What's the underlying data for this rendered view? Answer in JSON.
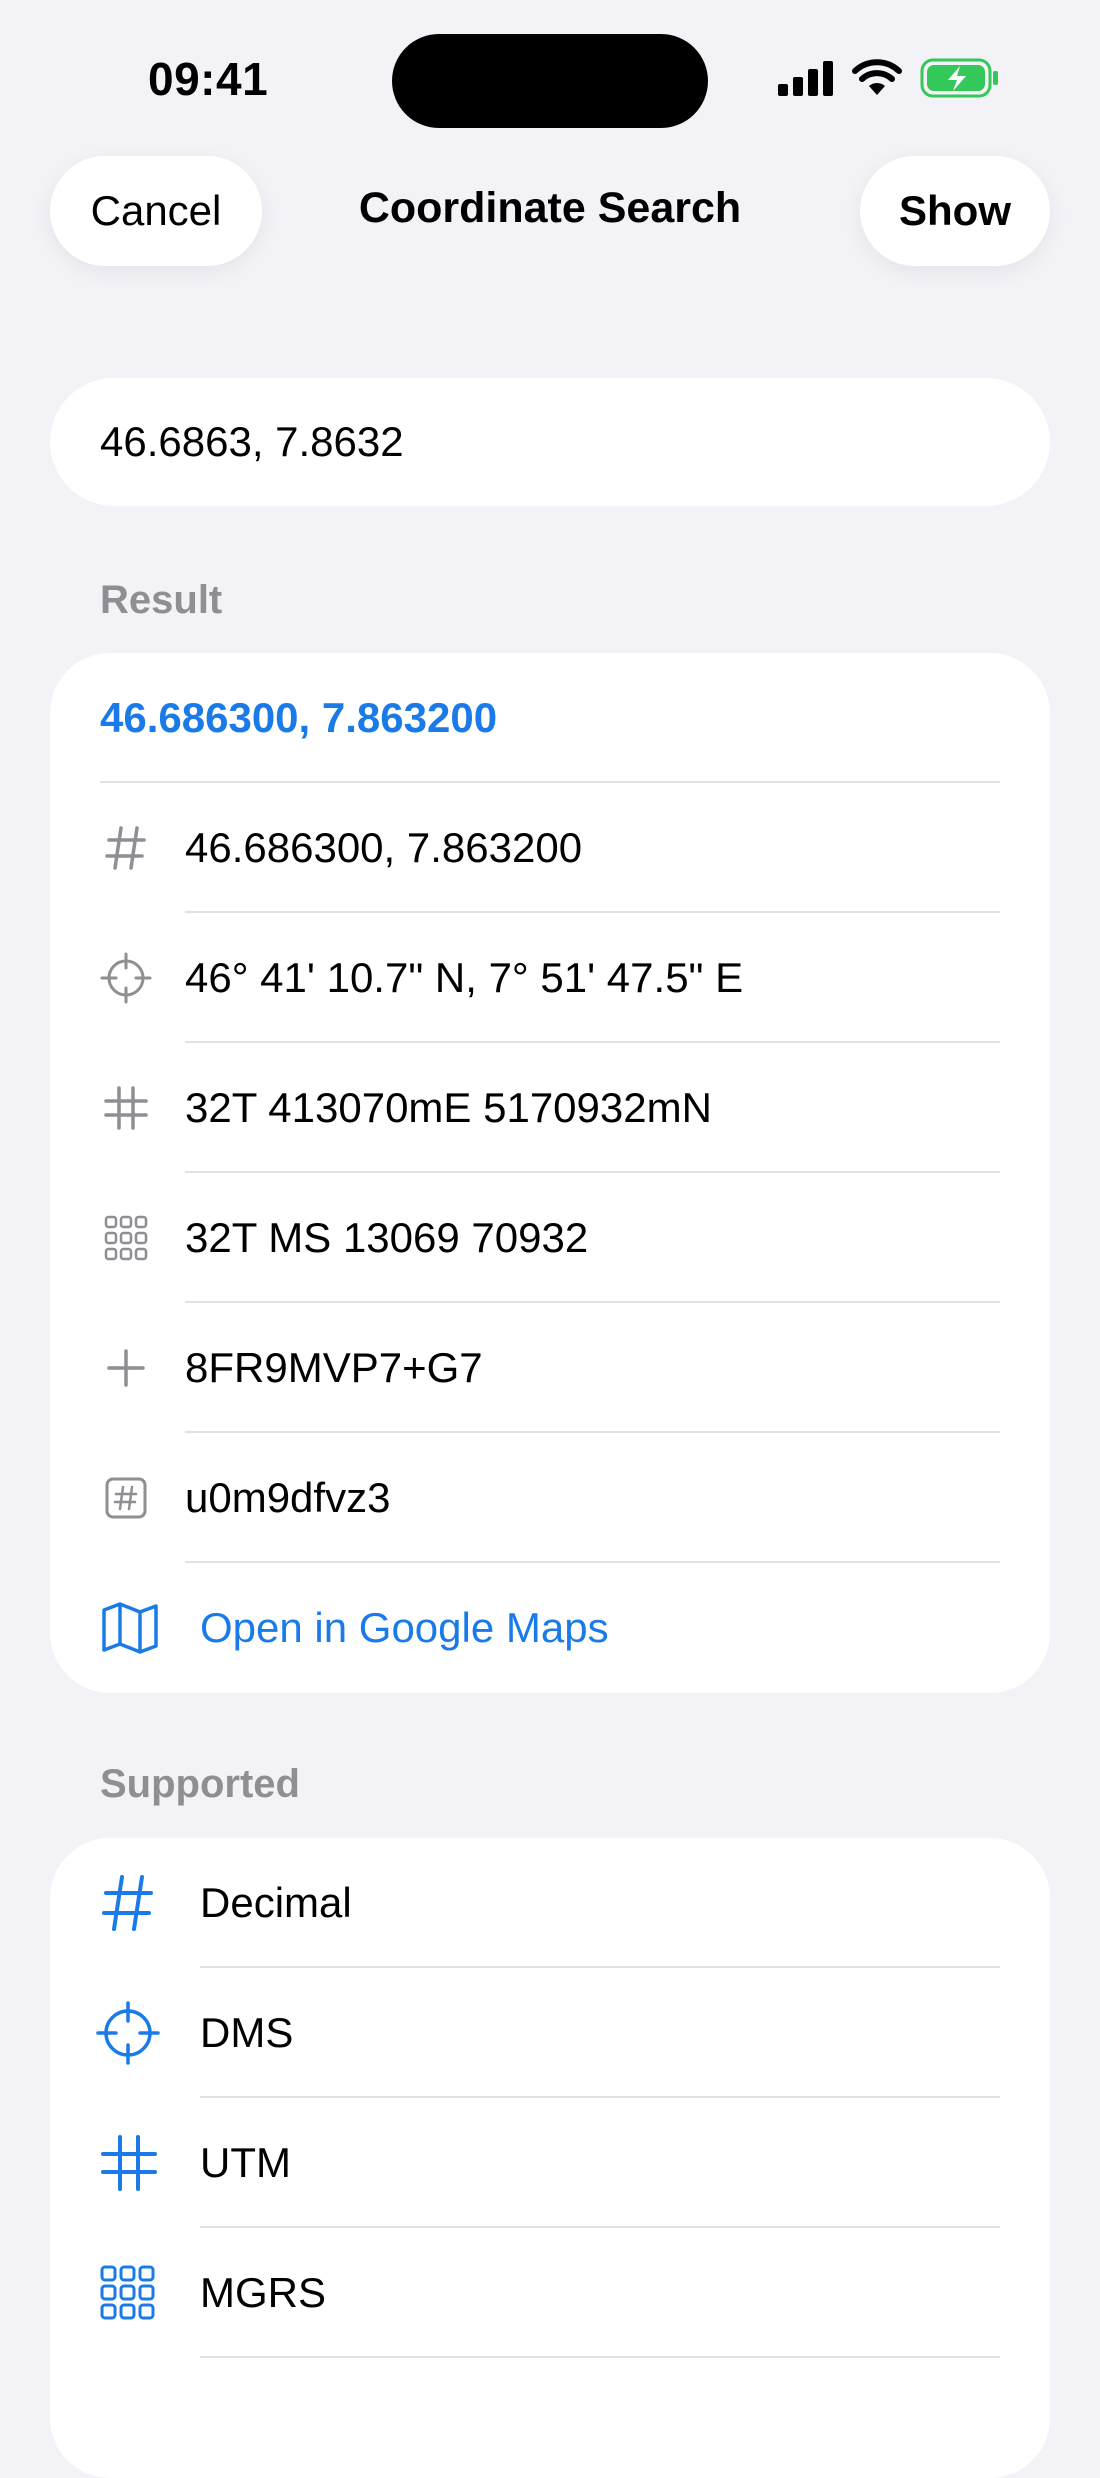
{
  "status": {
    "time": "09:41"
  },
  "nav": {
    "cancel": "Cancel",
    "title": "Coordinate Search",
    "show": "Show"
  },
  "search": {
    "value": "46.6863, 7.8632"
  },
  "result": {
    "header": "Result",
    "title": "46.686300, 7.863200",
    "rows": [
      {
        "icon": "number-sign-icon",
        "text": "46.686300, 7.863200"
      },
      {
        "icon": "crosshair-icon",
        "text": "46° 41' 10.7\" N, 7° 51' 47.5\" E"
      },
      {
        "icon": "grid-hash-icon",
        "text": "32T 413070mE 5170932mN"
      },
      {
        "icon": "dot-grid-icon",
        "text": "32T MS 13069 70932"
      },
      {
        "icon": "plus-icon",
        "text": "8FR9MVP7+G7"
      },
      {
        "icon": "hash-box-icon",
        "text": "u0m9dfvz3"
      }
    ],
    "link": {
      "icon": "map-icon",
      "text": "Open in Google Maps"
    }
  },
  "supported": {
    "header": "Supported",
    "items": [
      {
        "icon": "number-sign-icon",
        "text": "Decimal"
      },
      {
        "icon": "crosshair-icon",
        "text": "DMS"
      },
      {
        "icon": "grid-hash-icon",
        "text": "UTM"
      },
      {
        "icon": "dot-grid-icon",
        "text": "MGRS"
      }
    ]
  },
  "colors": {
    "accent": "#1A7BE8",
    "background": "#F2F2F7",
    "secondary": "#8E8E93",
    "battery": "#34C759"
  }
}
